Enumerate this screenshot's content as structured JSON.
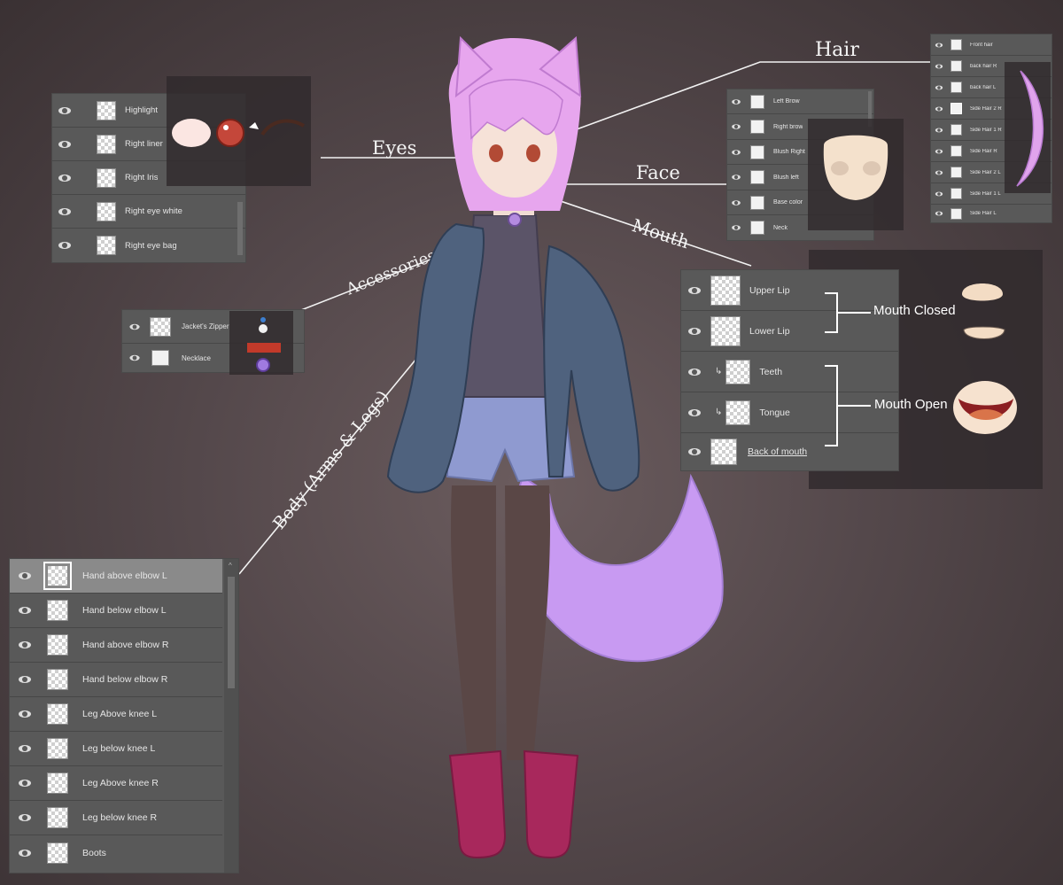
{
  "callouts": {
    "hair": "Hair",
    "eyes": "Eyes",
    "face": "Face",
    "mouth": "Mouth",
    "accessories": "Accessories",
    "body": "Body (Arms & Legs)"
  },
  "eyes_panel": {
    "layers": [
      "Highlight",
      "Right liner",
      "Right Iris",
      "Right eye white",
      "Right eye bag"
    ]
  },
  "face_panel": {
    "layers": [
      "Left Brow",
      "Right brow",
      "Blush Right",
      "Blush left",
      "Base color",
      "Neck"
    ]
  },
  "hair_panel": {
    "layers": [
      "Front hair",
      "back hair R",
      "back hair L",
      "Side Hair 2 R",
      "Side Hair 1 R",
      "Side Hair R",
      "Side Hair 2 L",
      "Side Hair 1 L",
      "Side Hair L"
    ]
  },
  "accessories_panel": {
    "layers": [
      "Jacket's Zipper",
      "Necklace"
    ]
  },
  "mouth_panel": {
    "layers": [
      "Upper Lip",
      "Lower Lip",
      "Teeth",
      "Tongue",
      "Back of mouth"
    ],
    "mouth_closed_label": "Mouth Closed",
    "mouth_open_label": "Mouth Open"
  },
  "body_panel": {
    "layers": [
      "Hand above elbow L",
      "Hand below elbow L",
      "Hand above elbow R",
      "Hand below elbow R",
      "Leg Above knee L",
      "Leg below knee L",
      "Leg Above knee R",
      "Leg below knee R",
      "Boots"
    ],
    "selected_index": 0
  },
  "colors": {
    "background": "#54484b",
    "panel": "#595959",
    "hair": "#e7a6ee",
    "jacket": "#4f627e",
    "shorts": "#8f9ad0",
    "boots": "#a8285c",
    "tail": "#c89af2"
  },
  "icons": [
    "eye-visibility-icon",
    "clipping-mask-arrow-icon"
  ]
}
